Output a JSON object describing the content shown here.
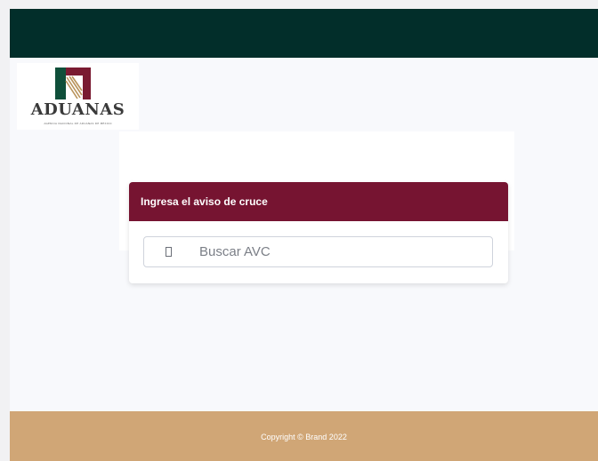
{
  "logo": {
    "title": "ADUANAS",
    "subtitle": "AGENCIA NACIONAL DE ADUANAS DE MÉXICO",
    "colors": {
      "green": "#0f4f3a",
      "maroon": "#7a1b32",
      "gold": "#b9935a"
    }
  },
  "card": {
    "header": "Ingresa el aviso de cruce",
    "search_placeholder": "Buscar AVC",
    "search_value": "",
    "icon": "clipboard-icon"
  },
  "footer": {
    "copyright": "Copyright © Brand 2022"
  },
  "colors": {
    "topbar": "#022e2a",
    "card_header": "#761431",
    "footer": "#d0a676",
    "background": "#f8f9fc"
  }
}
